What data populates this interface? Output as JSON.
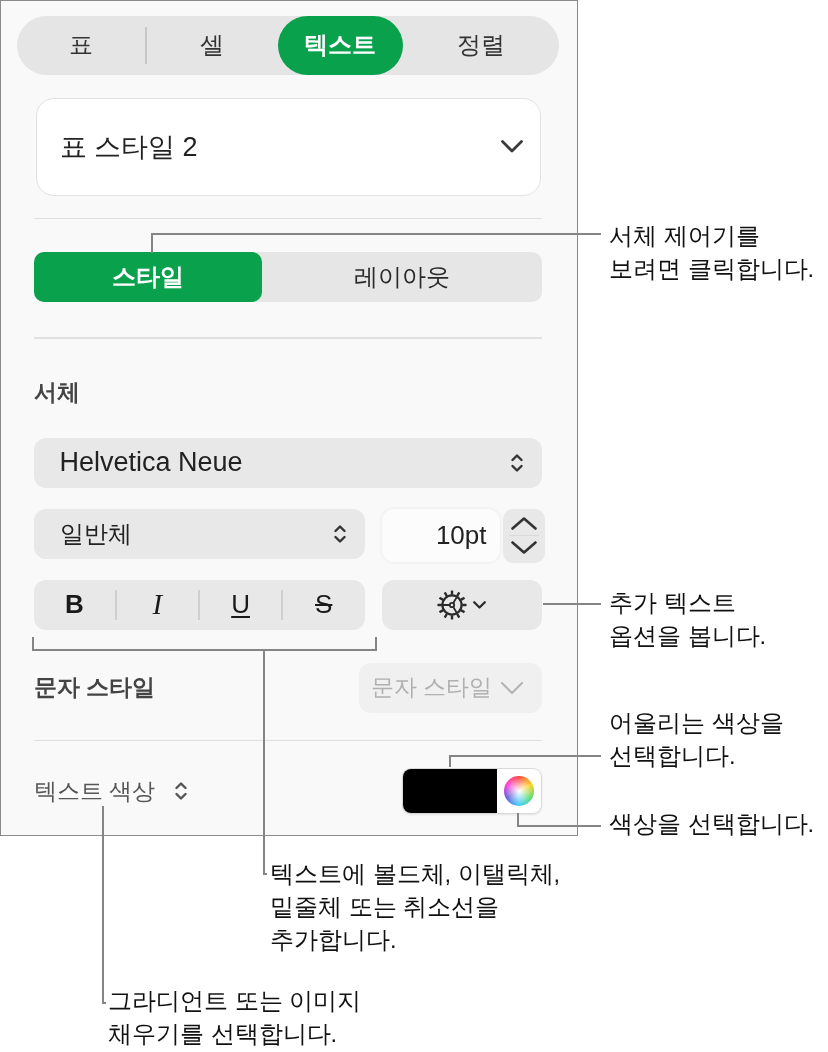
{
  "tabs": [
    {
      "label": "표",
      "selected": false
    },
    {
      "label": "셀",
      "selected": false
    },
    {
      "label": "텍스트",
      "selected": true
    },
    {
      "label": "정렬",
      "selected": false
    }
  ],
  "table_style": {
    "value": "표 스타일 2"
  },
  "text_mode": [
    {
      "label": "스타일",
      "selected": true
    },
    {
      "label": "레이아웃",
      "selected": false
    }
  ],
  "font": {
    "heading": "서체",
    "family": "Helvetica Neue",
    "typeface": "일반체",
    "size": "10pt",
    "format_buttons": [
      {
        "label": "B",
        "kind": "bold"
      },
      {
        "label": "I",
        "kind": "italic"
      },
      {
        "label": "U",
        "kind": "underline"
      },
      {
        "label": "S",
        "kind": "strikethrough"
      }
    ]
  },
  "character_style": {
    "heading": "문자 스타일",
    "value": "문자 스타일",
    "disabled": true
  },
  "text_color": {
    "label": "텍스트 색상",
    "color": "#000000"
  },
  "callouts": [
    {
      "text": "서체 제어기를\n보려면 클릭합니다."
    },
    {
      "text": "추가 텍스트\n옵션을 봅니다."
    },
    {
      "text": "어울리는 색상을\n선택합니다."
    },
    {
      "text": "색상을 선택합니다."
    },
    {
      "text": "텍스트에 볼드체, 이탤릭체,\n밑줄체 또는 취소선을\n추가합니다."
    },
    {
      "text": "그라디언트 또는 이미지\n채우기를 선택합니다."
    }
  ]
}
